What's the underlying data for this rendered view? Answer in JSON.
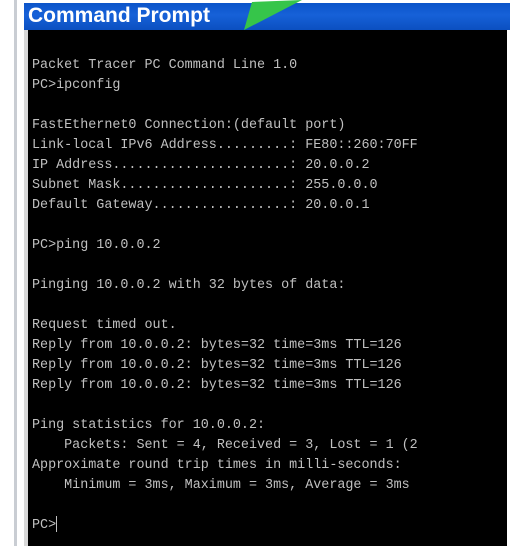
{
  "window": {
    "title": "Command Prompt"
  },
  "colors": {
    "titlebar": "#1661d8",
    "title_accent": "#36c54a",
    "console_bg": "#000000",
    "console_text": "#c0c0c0"
  },
  "console": {
    "lines": [
      "Packet Tracer PC Command Line 1.0",
      "PC>ipconfig",
      "",
      "FastEthernet0 Connection:(default port)",
      "Link-local IPv6 Address.........: FE80::260:70FF",
      "IP Address......................: 20.0.0.2",
      "Subnet Mask.....................: 255.0.0.0",
      "Default Gateway.................: 20.0.0.1",
      "",
      "PC>ping 10.0.0.2",
      "",
      "Pinging 10.0.0.2 with 32 bytes of data:",
      "",
      "Request timed out.",
      "Reply from 10.0.0.2: bytes=32 time=3ms TTL=126",
      "Reply from 10.0.0.2: bytes=32 time=3ms TTL=126",
      "Reply from 10.0.0.2: bytes=32 time=3ms TTL=126",
      "",
      "Ping statistics for 10.0.0.2:",
      "    Packets: Sent = 4, Received = 3, Lost = 1 (2",
      "Approximate round trip times in milli-seconds:",
      "    Minimum = 3ms, Maximum = 3ms, Average = 3ms"
    ],
    "prompt": "PC>"
  }
}
